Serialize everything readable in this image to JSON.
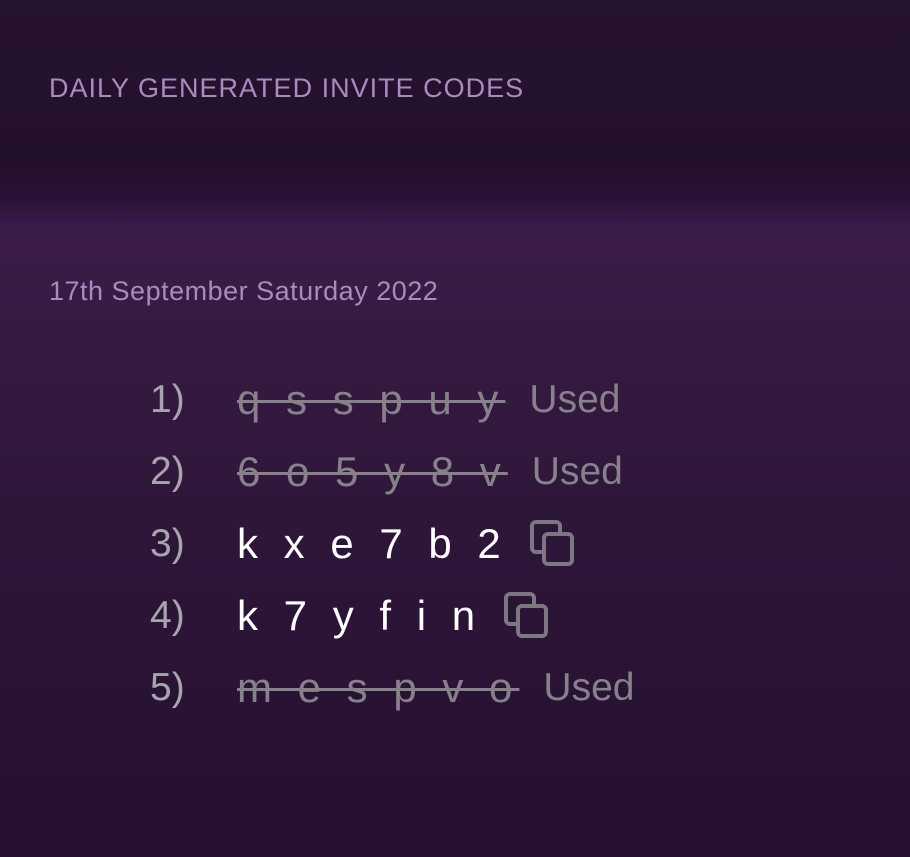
{
  "header": {
    "title": "DAILY GENERATED INVITE CODES"
  },
  "content": {
    "date": "17th September Saturday 2022",
    "codes": [
      {
        "number": "1)",
        "code": "q s s p u y",
        "used": true,
        "status": "Used"
      },
      {
        "number": "2)",
        "code": "6 o 5 y 8 v",
        "used": true,
        "status": "Used"
      },
      {
        "number": "3)",
        "code": "k x e 7 b 2",
        "used": false,
        "icon": "copy-icon"
      },
      {
        "number": "4)",
        "code": "k 7 y f i n",
        "used": false,
        "icon": "copy-icon"
      },
      {
        "number": "5)",
        "code": "m e s p v o",
        "used": true,
        "status": "Used"
      }
    ]
  },
  "colors": {
    "background": "#240f2c",
    "accent_text": "#a98bc0",
    "used_text": "#86818b",
    "active_code": "#ffffff"
  }
}
